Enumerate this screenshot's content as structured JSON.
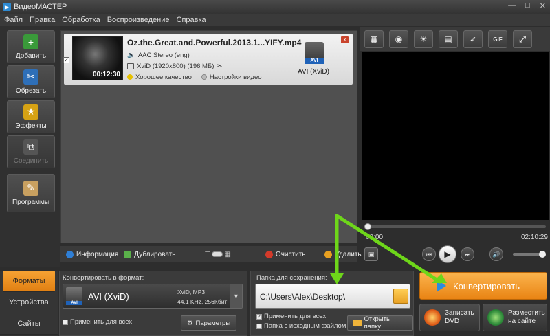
{
  "window": {
    "title": "ВидеоМАСТЕР",
    "minimize": "—",
    "maximize": "□",
    "close": "✕"
  },
  "menu": [
    "Файл",
    "Правка",
    "Обработка",
    "Воспроизведение",
    "Справка"
  ],
  "sidebar": {
    "items": [
      {
        "label": "Добавить",
        "icon": "add-film-icon",
        "color": "#3a9a3a"
      },
      {
        "label": "Обрезать",
        "icon": "scissors-film-icon",
        "color": "#2e6fb8"
      },
      {
        "label": "Эффекты",
        "icon": "star-effects-icon",
        "color": "#d6a214"
      },
      {
        "label": "Соединить",
        "icon": "join-film-icon",
        "color": "#666666"
      },
      {
        "label": "Программы",
        "icon": "programs-icon",
        "color": "#c8a060"
      }
    ]
  },
  "file": {
    "name": "Oz.the.Great.and.Powerful.2013.1...YIFY.mp4",
    "audio": "AAC Stereo (eng)",
    "video": "XviD (1920x800) (196 МБ)",
    "duration": "00:12:30",
    "quality": "Хорошее качество",
    "settings": "Настройки видео",
    "format_badge": "AVI",
    "format_label": "AVI (XviD)",
    "checkmark": "✓",
    "close": "x"
  },
  "actions": {
    "info": "Информация",
    "duplicate": "Дублировать",
    "clear": "Очистить",
    "delete": "Удалить"
  },
  "preview": {
    "tools": [
      "▦",
      "◉",
      "☀",
      "▤",
      "➶",
      "GIF",
      "⤢"
    ],
    "time_current": "00:00",
    "time_total": "02:10:29",
    "buttons": {
      "prev": "⏮",
      "play": "▶",
      "next": "⏭",
      "volume": "🔊",
      "snapshot": "▣"
    },
    "progress": 0.0,
    "volume": 1.0
  },
  "bottom_tabs": [
    "Форматы",
    "Устройства",
    "Сайты"
  ],
  "convert_panel": {
    "label": "Конвертировать в формат:",
    "badge": "AVI",
    "format": "AVI (XviD)",
    "spec1": "XviD, MP3",
    "spec2": "44,1 KHz, 256Кбит",
    "dropdown": "▼",
    "apply_all": "Применить для всех",
    "params": "Параметры",
    "params_icon": "⚙"
  },
  "save_panel": {
    "label": "Папка для сохранения:",
    "path": "C:\\Users\\Alex\\Desktop\\",
    "apply_all": "Применить для всех",
    "source_folder": "Папка с исходным файлом",
    "open_folder": "Открыть папку",
    "check": "✓"
  },
  "right_actions": {
    "convert": "Конвертировать",
    "dvd_line1": "Записать",
    "dvd_line2": "DVD",
    "web_line1": "Разместить",
    "web_line2": "на сайте"
  },
  "colors": {
    "accent_orange": "#f29a2a",
    "arrow_green": "#6ed61a",
    "avi_blue": "#1f62b8"
  }
}
